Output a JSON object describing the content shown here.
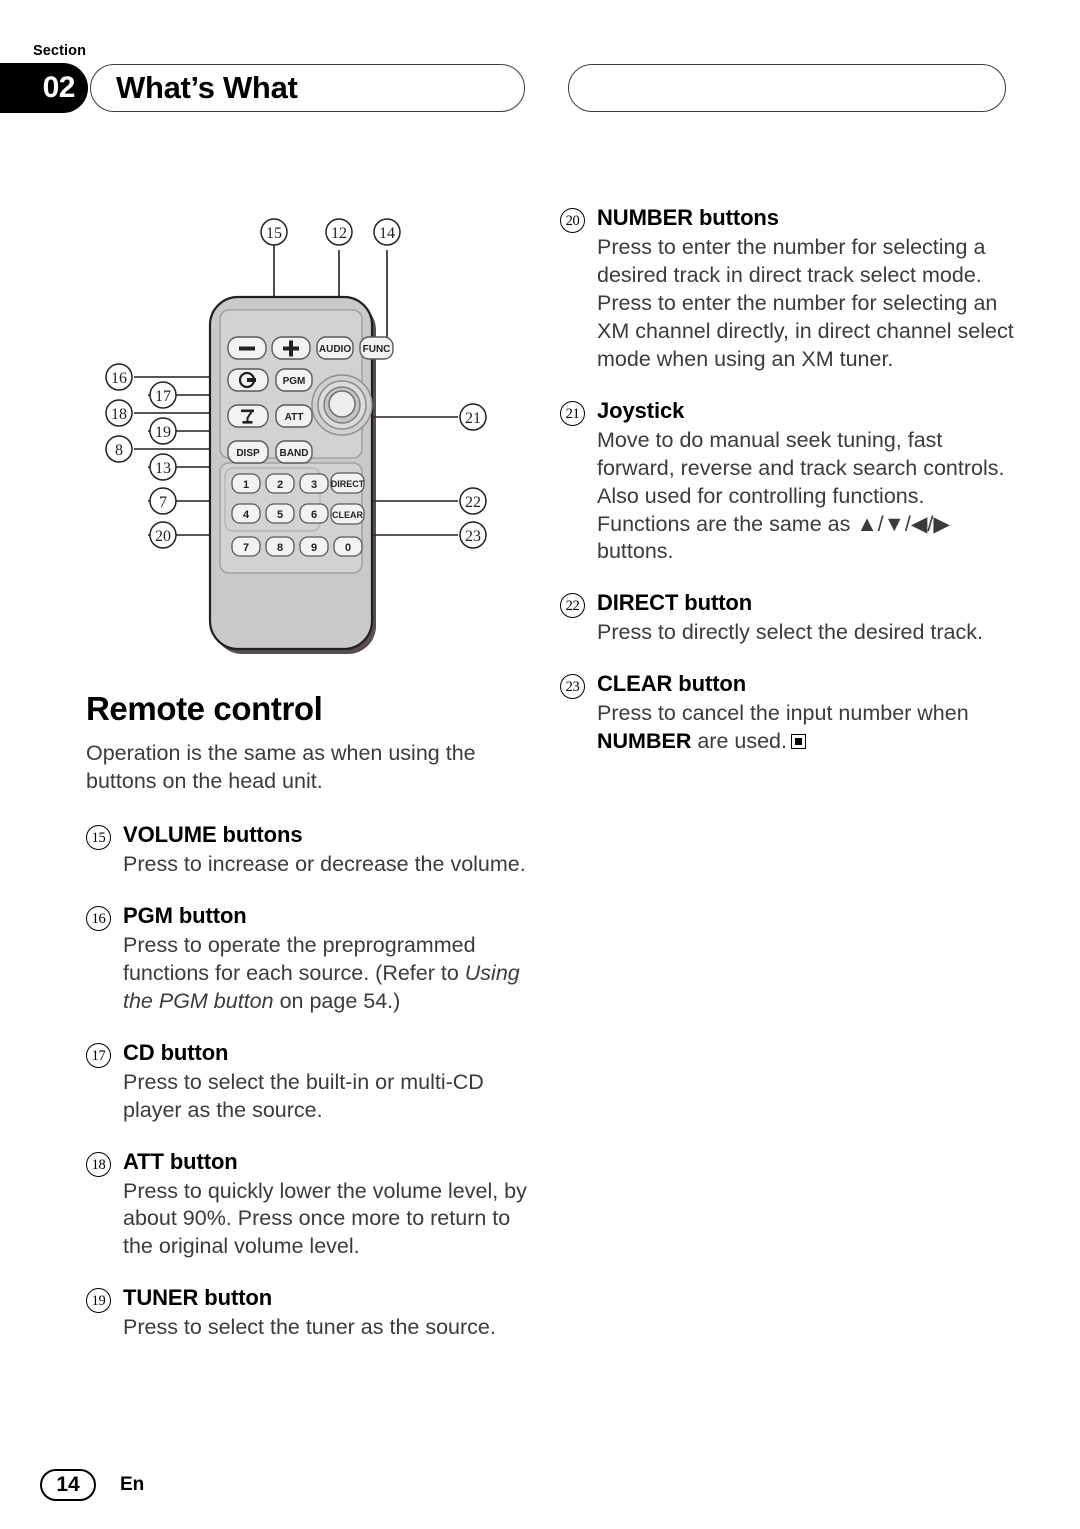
{
  "header": {
    "section_label": "Section",
    "section_number": "02",
    "title": "What’s What",
    "right_tab_title": ""
  },
  "footer": {
    "page_number": "14",
    "language_code": "En"
  },
  "left_column": {
    "heading": "Remote control",
    "intro": "Operation is the same as when using the buttons on the head unit.",
    "entries": [
      {
        "num": "15",
        "title": "VOLUME buttons",
        "body": "Press to increase or decrease the volume."
      },
      {
        "num": "16",
        "title": "PGM button",
        "body_pre": "Press to operate the preprogrammed functions for each source. (Refer to ",
        "body_italic": "Using the PGM button",
        "body_post": " on page 54.)"
      },
      {
        "num": "17",
        "title": "CD button",
        "body": "Press to select the built-in or multi-CD player as the source."
      },
      {
        "num": "18",
        "title": "ATT button",
        "body": "Press to quickly lower the volume level, by about 90%. Press once more to return to the original volume level."
      },
      {
        "num": "19",
        "title": "TUNER button",
        "body": "Press to select the tuner as the source."
      }
    ]
  },
  "right_column": {
    "entries": [
      {
        "num": "20",
        "title": "NUMBER buttons",
        "body": "Press to enter the number for selecting a desired track in direct track select mode. Press to enter the number for selecting an XM channel directly, in direct channel select mode when using an XM tuner."
      },
      {
        "num": "21",
        "title": "Joystick",
        "body_pre": "Move to do manual seek tuning, fast forward, reverse and track search controls. Also used for controlling functions. Functions are the same as ",
        "body_arrows": "▲/▼/◀/▶",
        "body_post": " buttons."
      },
      {
        "num": "22",
        "title": "DIRECT button",
        "body": "Press to directly select the desired track."
      },
      {
        "num": "23",
        "title": "CLEAR button",
        "body_pre": "Press to cancel the input number when ",
        "body_bold": "NUMBER",
        "body_post": " are used."
      }
    ]
  },
  "remote": {
    "alt": "Remote control unit diagram",
    "callouts_top": [
      "15",
      "12",
      "14"
    ],
    "callouts_left": [
      "16",
      "17",
      "18",
      "19",
      "8",
      "13",
      "7",
      "20"
    ],
    "callouts_right": [
      "21",
      "22",
      "23"
    ],
    "buttons": {
      "volume_minus": "−",
      "volume_plus": "+",
      "audio": "AUDIO",
      "func": "FUNC",
      "pgm": "PGM",
      "att": "ATT",
      "disp": "DISP",
      "band": "BAND",
      "direct": "DIRECT",
      "clear": "CLEAR",
      "cd": "cd-eject-icon",
      "tuner": "tuner-antenna-icon",
      "joystick": "joystick-dial"
    },
    "number_keys": [
      "1",
      "2",
      "3",
      "4",
      "5",
      "6",
      "7",
      "8",
      "9",
      "0"
    ],
    "colors": {
      "body_fill": "#c9c9c9",
      "body_stroke": "#231f20",
      "panel_fill": "#d2d2d2",
      "key_fill": "#f2f2f2",
      "key_stroke": "#58595b",
      "callout_line": "#231f20"
    }
  }
}
